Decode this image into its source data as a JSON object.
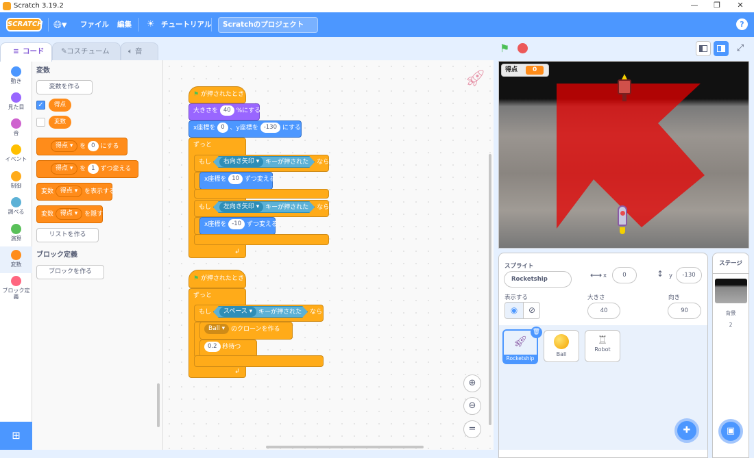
{
  "window": {
    "title": "Scratch 3.19.2",
    "controls": [
      "—",
      "❐",
      "✕"
    ]
  },
  "menu": {
    "logo": "SCRATCH",
    "file": "ファイル",
    "edit": "編集",
    "tutorials": "チュートリアル",
    "project_title": "Scratchのプロジェクト",
    "help": "?"
  },
  "tabs": [
    {
      "label": "コード"
    },
    {
      "label": "コスチューム"
    },
    {
      "label": "音"
    }
  ],
  "categories": [
    {
      "label": "動き",
      "color": "#4c97ff"
    },
    {
      "label": "見た目",
      "color": "#9966ff"
    },
    {
      "label": "音",
      "color": "#cf63cf"
    },
    {
      "label": "イベント",
      "color": "#ffbf00"
    },
    {
      "label": "制御",
      "color": "#ffab19"
    },
    {
      "label": "調べる",
      "color": "#5cb1d6"
    },
    {
      "label": "演算",
      "color": "#59c059"
    },
    {
      "label": "変数",
      "color": "#ff8c1a"
    },
    {
      "label": "ブロック定義",
      "color": "#ff6680"
    }
  ],
  "palette": {
    "heading": "変数",
    "make_var": "変数を作る",
    "var1": "得点",
    "var2": "変数",
    "set_to": "を",
    "set_end": "にする",
    "set_val": "0",
    "change_val": "1",
    "change_end": "ずつ変える",
    "show_pre": "変数",
    "show_end": "を表示する",
    "hide_pre": "変数",
    "hide_end": "を隠す",
    "make_list": "リストを作る",
    "defs_heading": "ブロック定義",
    "make_block": "ブロックを作る"
  },
  "script1": {
    "hat": "が押されたとき",
    "size_pre": "大きさを",
    "size_val": "40",
    "size_end": "%にする",
    "goto_x": "x座標を",
    "x_val": "0",
    "goto_y": "、y座標を",
    "y_val": "-130",
    "goto_end": "にする",
    "forever": "ずっと",
    "if": "もし",
    "key_right": "右向き矢印",
    "key_pressed": "キーが押された",
    "then": "なら",
    "change_x": "x座標を",
    "cx_val": "10",
    "change_end": "ずつ変える",
    "key_left": "左向き矢印",
    "cx_val2": "-10"
  },
  "script2": {
    "hat": "が押されたとき",
    "forever": "ずっと",
    "if": "もし",
    "key": "スペース",
    "key_pressed": "キーが押された",
    "then": "なら",
    "clone_target": "Ball",
    "clone_end": "のクローンを作る",
    "wait_val": "0.2",
    "wait_end": "秒待つ"
  },
  "stage": {
    "monitor_label": "得点",
    "monitor_value": "0"
  },
  "sprite_info": {
    "label": "スプライト",
    "name": "Rocketship",
    "x_label": "x",
    "x": "0",
    "y_label": "y",
    "y": "-130",
    "show_label": "表示する",
    "size_label": "大きさ",
    "size": "40",
    "direction_label": "向き",
    "direction": "90"
  },
  "sprites": [
    {
      "name": "Rocketship"
    },
    {
      "name": "Ball"
    },
    {
      "name": "Robot"
    }
  ],
  "stage_panel": {
    "title": "ステージ",
    "backdrops_label": "背景",
    "backdrops_count": "2"
  }
}
